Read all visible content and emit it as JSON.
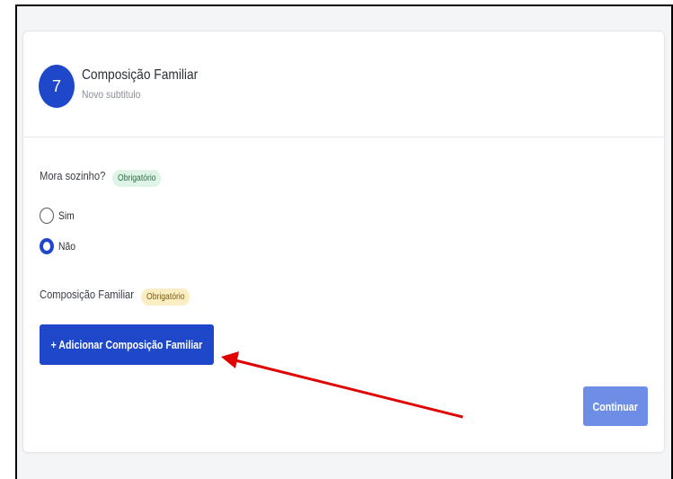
{
  "step": {
    "number": "7",
    "title": "Composição Familiar",
    "subtitle": "Novo subtitulo"
  },
  "question1": {
    "label": "Mora sozinho?",
    "badge": "Obrigatório",
    "options": [
      {
        "label": "Sim",
        "checked": false
      },
      {
        "label": "Não",
        "checked": true
      }
    ]
  },
  "question2": {
    "label": "Composição Familiar",
    "badge": "Obrigatório"
  },
  "add_button": {
    "label": "+  Adicionar Composição Familiar"
  },
  "continue_button": {
    "label": "Continuar"
  },
  "colors": {
    "primary": "#1f47c9",
    "primary_disabled": "#6d8ee4",
    "badge_green_bg": "#dff3e6",
    "badge_yellow_bg": "#fbeec3",
    "annotation_arrow": "#e00000"
  },
  "annotation": {
    "icon": "red-arrow-icon",
    "points_to": "add-composicao-familiar-button"
  }
}
